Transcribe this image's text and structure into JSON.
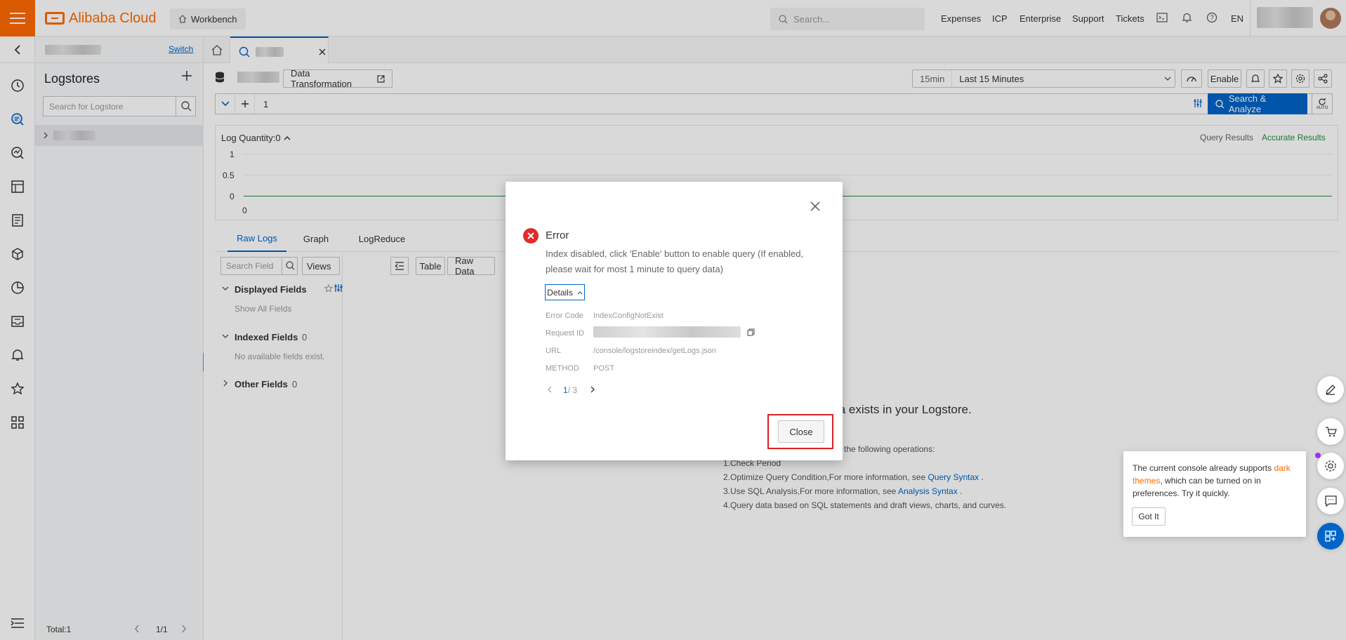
{
  "header": {
    "brand": "Alibaba Cloud",
    "workbench": "Workbench",
    "search_placeholder": "Search...",
    "nav": [
      "Expenses",
      "ICP",
      "Enterprise",
      "Support",
      "Tickets"
    ],
    "lang": "EN"
  },
  "subnav": {
    "switch_label": "Switch",
    "title": "Logstores",
    "search_placeholder": "Search for Logstore",
    "total": "Total:1",
    "page": "1/1"
  },
  "toolbar": {
    "data_transformation": "Data Transformation",
    "time_short": "15min",
    "time_label": "Last 15 Minutes",
    "enable": "Enable",
    "query_line": "1",
    "search_analyze": "Search & Analyze",
    "auto": "AUTO"
  },
  "histogram": {
    "title": "Log Quantity:0",
    "query_results": "Query Results",
    "accurate_results": "Accurate Results",
    "y_ticks": [
      "1",
      "0.5",
      "0"
    ],
    "x_start": "0"
  },
  "result_tabs": [
    "Raw Logs",
    "Graph",
    "LogReduce"
  ],
  "fields": {
    "search_placeholder": "Search Field",
    "views": "Views",
    "displayed": "Displayed Fields",
    "show_all": "Show All Fields",
    "indexed": "Indexed Fields",
    "indexed_count": "0",
    "no_fields": "No available fields exist.",
    "other": "Other Fields",
    "other_count": "0"
  },
  "view_buttons": [
    "Table",
    "Raw Data"
  ],
  "empty_state": {
    "heading": "ta exists in your Logstore.",
    "intro": "the following operations:",
    "step1": "1.Check Period",
    "step2_pre": "2.Optimize Query Condition,For more information, see ",
    "step2_link": "Query Syntax",
    "step2_post": " .",
    "step3_pre": "3.Use SQL Analysis,For more information, see ",
    "step3_link": "Analysis Syntax",
    "step3_post": " .",
    "step4": "4.Query data based on SQL statements and draft views, charts, and curves."
  },
  "dialog": {
    "title": "Error",
    "message": "Index disabled, click 'Enable' button to enable query (If enabled, please wait for most 1 minute to query data)",
    "details_label": "Details",
    "rows": [
      {
        "key": "Error Code",
        "value": "IndexConfigNotExist"
      },
      {
        "key": "Request ID",
        "value": ""
      },
      {
        "key": "URL",
        "value": "/console/logstoreindex/getLogs.json"
      },
      {
        "key": "METHOD",
        "value": "POST"
      }
    ],
    "pager_current": "1",
    "pager_total": "/ 3",
    "close": "Close"
  },
  "tip": {
    "text_pre": "The current console already supports ",
    "text_link": "dark themes",
    "text_post": ", which can be turned on in preferences. Try it quickly.",
    "got_it": "Got It"
  },
  "colors": {
    "brand": "#ff6a00",
    "primary": "#0064c8",
    "error": "#e22b2b",
    "success": "#1e8e3e"
  }
}
